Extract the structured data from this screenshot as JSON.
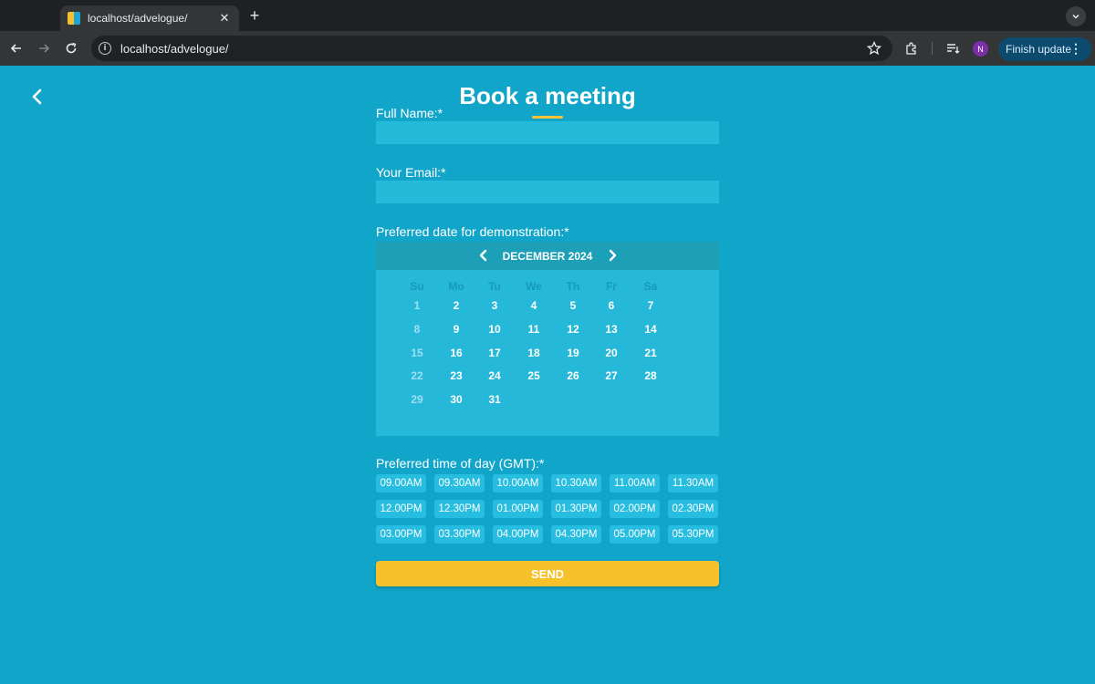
{
  "browser": {
    "tab_title": "localhost/advelogue/",
    "url": "localhost/advelogue/",
    "profile_initial": "N",
    "update_label": "Finish update"
  },
  "page": {
    "title": "Book a meeting",
    "accent_color": "#f5c23a",
    "background_color": "#11a5c9"
  },
  "form": {
    "full_name_label": "Full Name:*",
    "full_name_value": "",
    "email_label": "Your Email:*",
    "email_value": "",
    "date_label": "Preferred date for demonstration:*",
    "time_label": "Preferred time of day (GMT):*",
    "send_label": "SEND"
  },
  "calendar": {
    "month": "DECEMBER 2024",
    "weekdays": [
      "Su",
      "Mo",
      "Tu",
      "We",
      "Th",
      "Fr",
      "Sa"
    ],
    "weeks": [
      [
        "1",
        "2",
        "3",
        "4",
        "5",
        "6",
        "7"
      ],
      [
        "8",
        "9",
        "10",
        "11",
        "12",
        "13",
        "14"
      ],
      [
        "15",
        "16",
        "17",
        "18",
        "19",
        "20",
        "21"
      ],
      [
        "22",
        "23",
        "24",
        "25",
        "26",
        "27",
        "28"
      ],
      [
        "29",
        "30",
        "31"
      ]
    ]
  },
  "times": [
    [
      "09.00AM",
      "09.30AM",
      "10.00AM",
      "10.30AM",
      "11.00AM",
      "11.30AM"
    ],
    [
      "12.00PM",
      "12.30PM",
      "01.00PM",
      "01.30PM",
      "02.00PM",
      "02.30PM"
    ],
    [
      "03.00PM",
      "03.30PM",
      "04.00PM",
      "04.30PM",
      "05.00PM",
      "05.30PM"
    ]
  ]
}
